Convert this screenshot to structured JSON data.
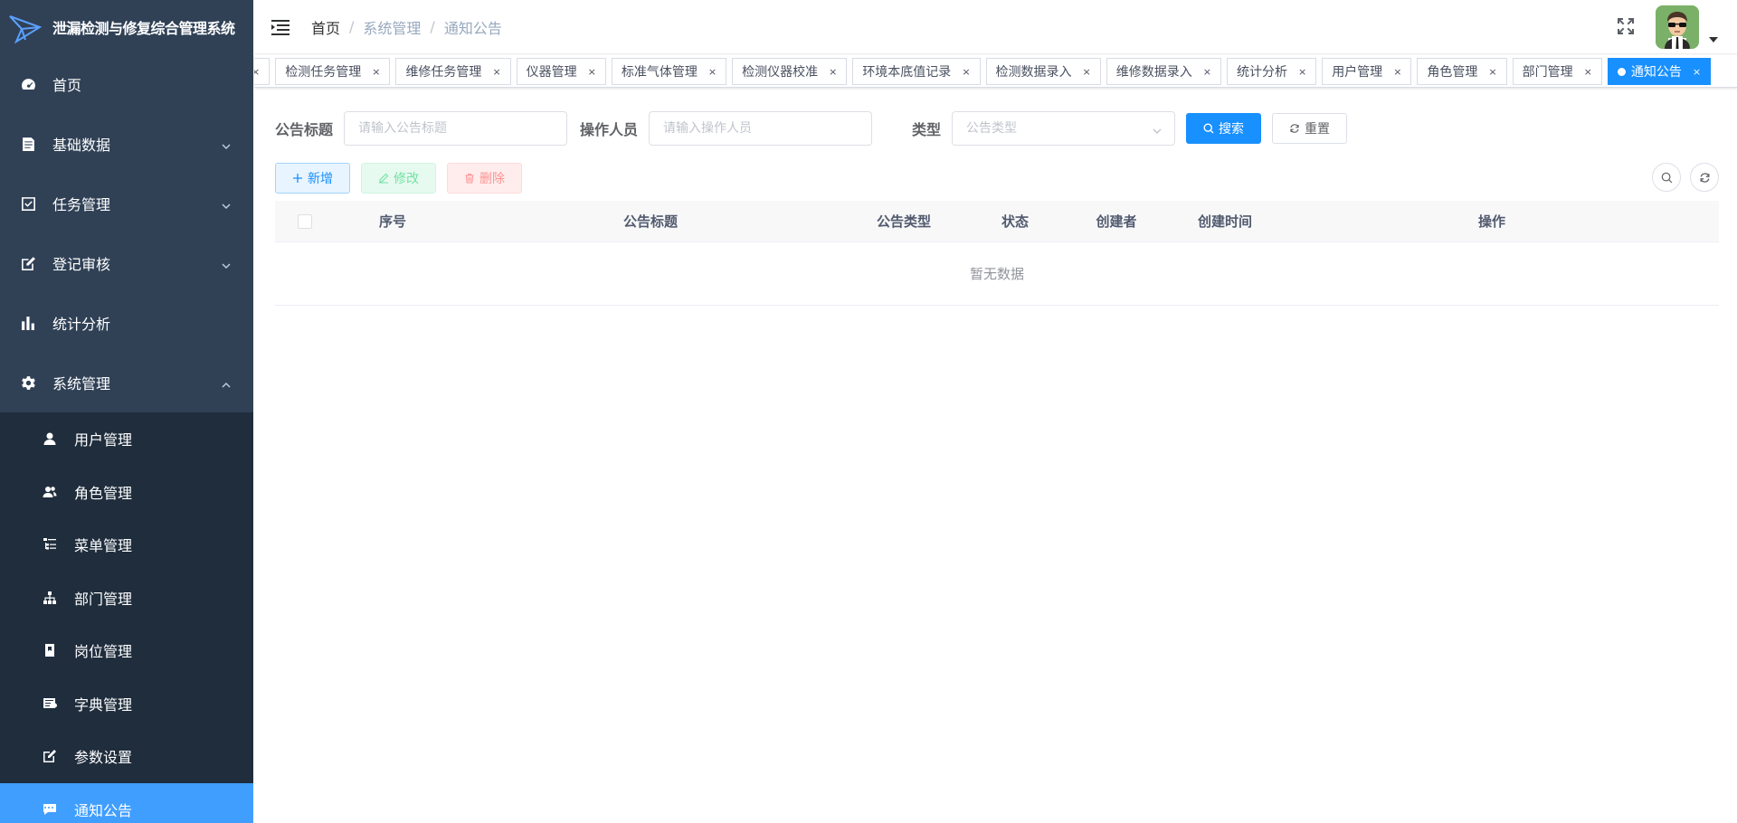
{
  "app": {
    "title": "泄漏检测与修复综合管理系统",
    "accent_color": "#409eff",
    "sidebar_color": "#304156",
    "primary_color": "#1890ff"
  },
  "sidebar": {
    "items": [
      {
        "label": "首页",
        "icon": "dashboard-icon"
      },
      {
        "label": "基础数据",
        "icon": "document-icon"
      },
      {
        "label": "任务管理",
        "icon": "checkbox-icon"
      },
      {
        "label": "登记审核",
        "icon": "edit-icon"
      },
      {
        "label": "统计分析",
        "icon": "bar-chart-icon"
      },
      {
        "label": "系统管理",
        "icon": "gear-icon"
      }
    ],
    "sub_items": [
      {
        "label": "用户管理",
        "icon": "user-icon"
      },
      {
        "label": "角色管理",
        "icon": "peoples-icon"
      },
      {
        "label": "菜单管理",
        "icon": "tree-table-icon"
      },
      {
        "label": "部门管理",
        "icon": "tree-icon"
      },
      {
        "label": "岗位管理",
        "icon": "post-icon"
      },
      {
        "label": "字典管理",
        "icon": "dict-icon"
      },
      {
        "label": "参数设置",
        "icon": "edit-icon"
      },
      {
        "label": "通知公告",
        "icon": "message-icon"
      }
    ]
  },
  "breadcrumb": [
    "首页",
    "系统管理",
    "通知公告"
  ],
  "tags": [
    {
      "label": ""
    },
    {
      "label": "检测任务管理"
    },
    {
      "label": "维修任务管理"
    },
    {
      "label": "仪器管理"
    },
    {
      "label": "标准气体管理"
    },
    {
      "label": "检测仪器校准"
    },
    {
      "label": "环境本底值记录"
    },
    {
      "label": "检测数据录入"
    },
    {
      "label": "维修数据录入"
    },
    {
      "label": "统计分析"
    },
    {
      "label": "用户管理"
    },
    {
      "label": "角色管理"
    },
    {
      "label": "部门管理"
    },
    {
      "label": "通知公告"
    }
  ],
  "tag_close": "×",
  "search": {
    "title_label": "公告标题",
    "title_placeholder": "请输入公告标题",
    "operator_label": "操作人员",
    "operator_placeholder": "请输入操作人员",
    "type_label": "类型",
    "type_placeholder": "公告类型",
    "search_button": "搜索",
    "reset_button": "重置"
  },
  "actions": {
    "add": "新增",
    "edit": "修改",
    "delete": "删除"
  },
  "table": {
    "columns": [
      "序号",
      "公告标题",
      "公告类型",
      "状态",
      "创建者",
      "创建时间",
      "操作"
    ],
    "empty_text": "暂无数据"
  }
}
